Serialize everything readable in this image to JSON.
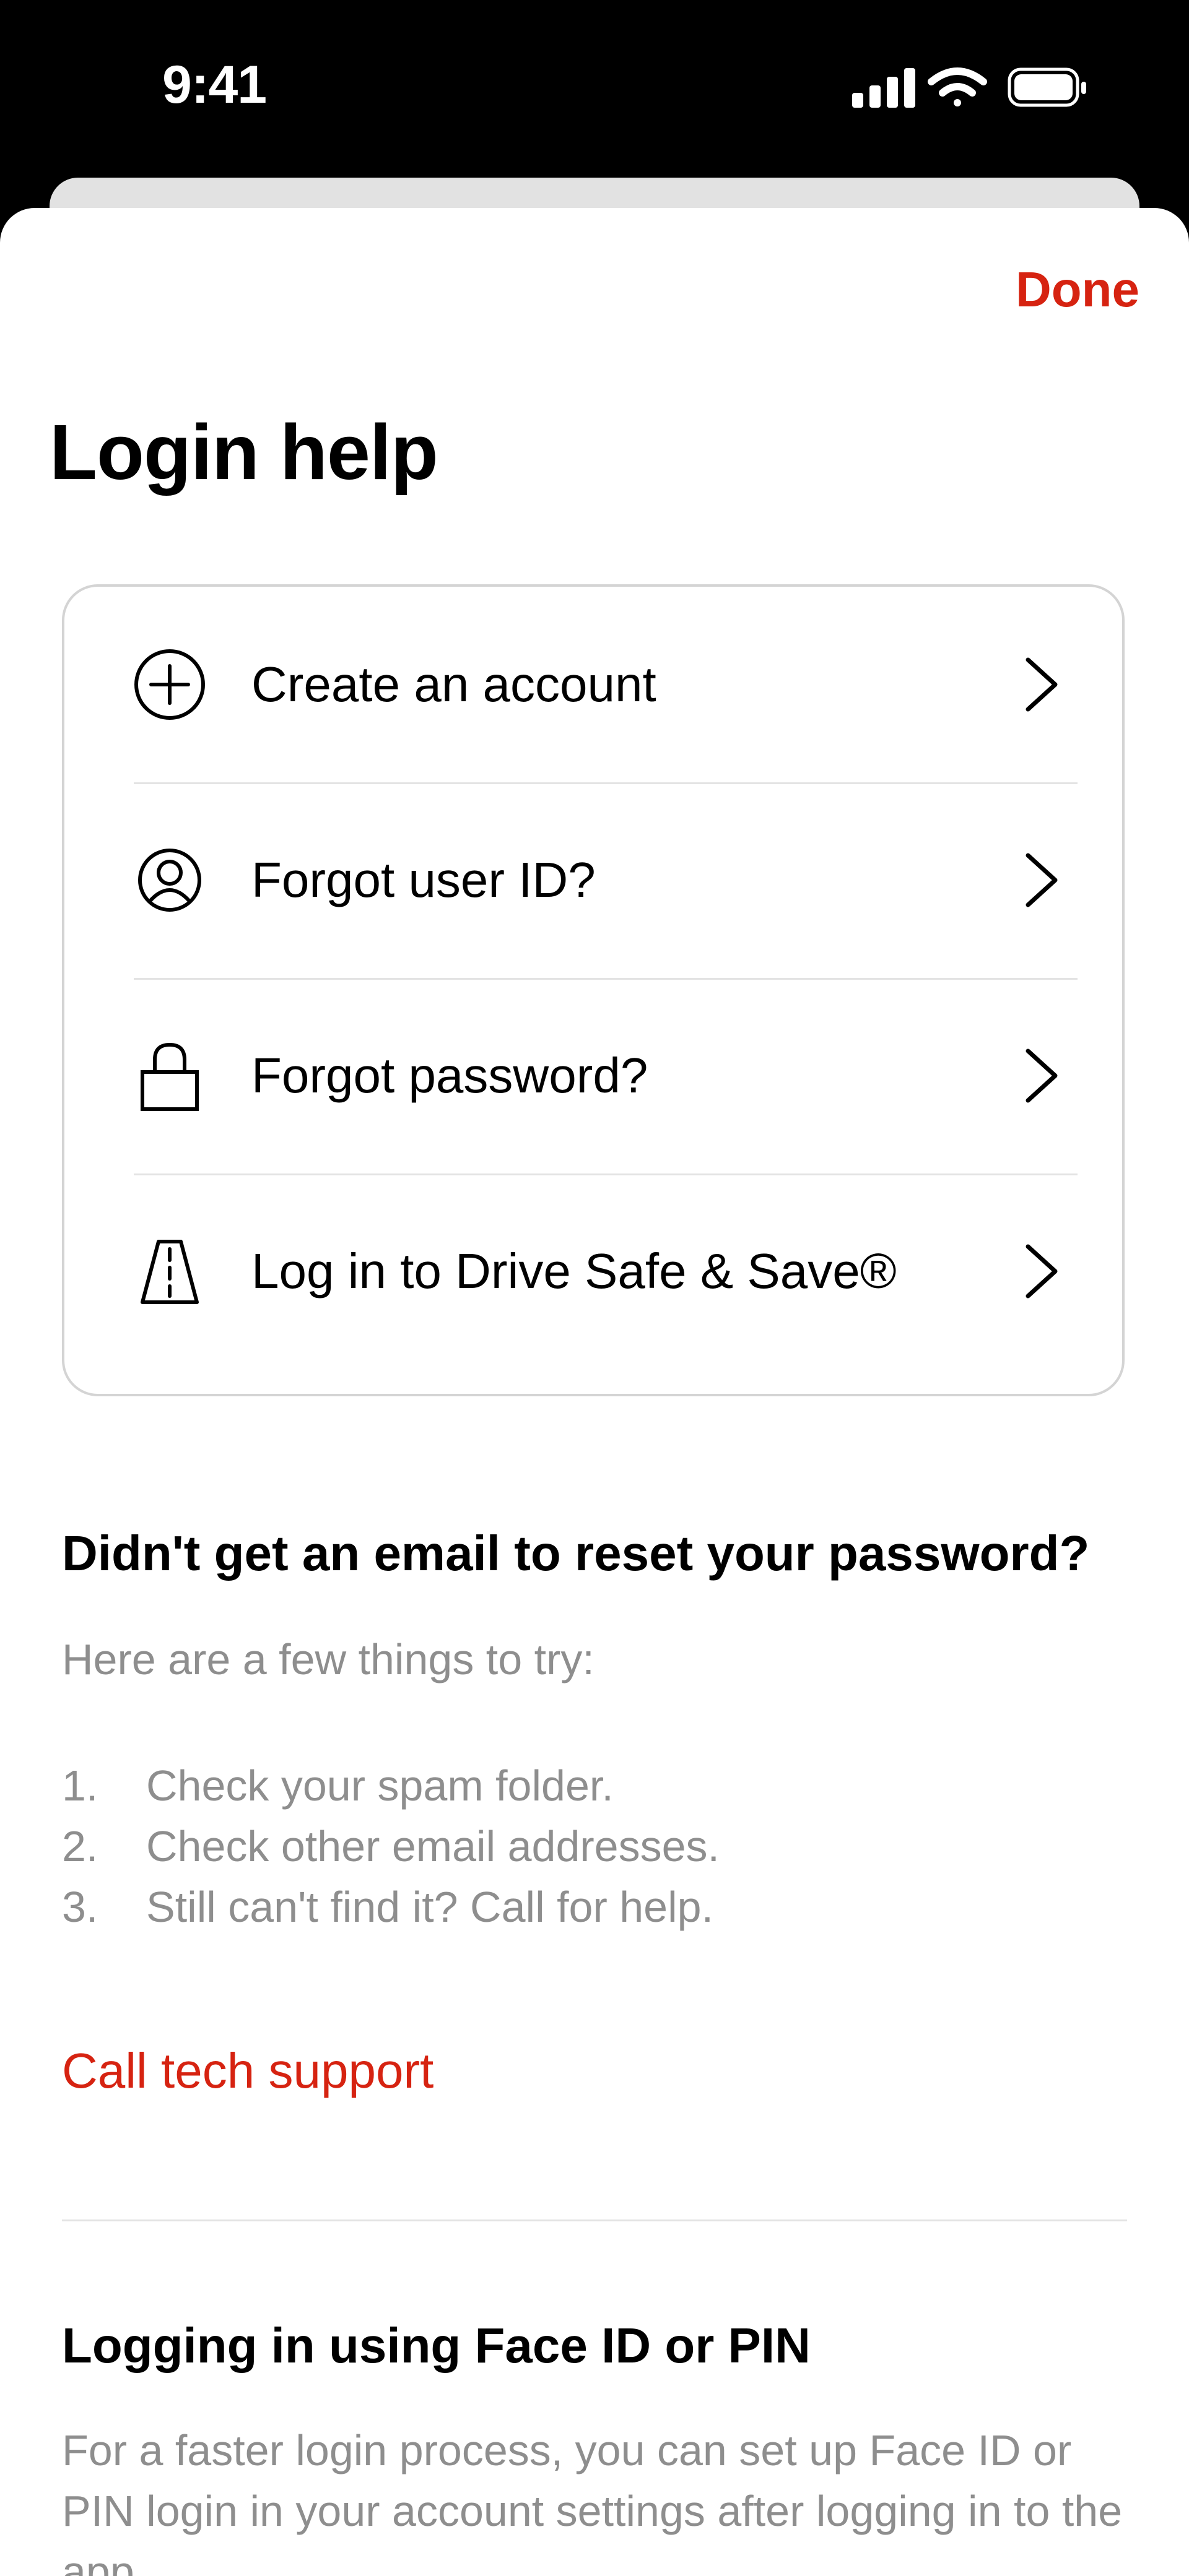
{
  "status_bar": {
    "time": "9:41",
    "icons": [
      "signal-icon",
      "wifi-icon",
      "battery-icon"
    ]
  },
  "header": {
    "done_label": "Done",
    "title": "Login help"
  },
  "menu": {
    "items": [
      {
        "label": "Create an account",
        "icon": "plus-circle-icon"
      },
      {
        "label": "Forgot user ID?",
        "icon": "user-circle-icon"
      },
      {
        "label": "Forgot password?",
        "icon": "lock-icon"
      },
      {
        "label": "Log in to Drive Safe & Save®",
        "icon": "road-icon"
      }
    ]
  },
  "reset_help": {
    "heading": "Didn't get an email to reset your password?",
    "intro": "Here are a few things to try:",
    "steps": [
      {
        "num": "1.",
        "text": "Check your spam folder."
      },
      {
        "num": "2.",
        "text": "Check other email addresses."
      },
      {
        "num": "3.",
        "text": "Still can't find it? Call for help."
      }
    ],
    "support_link": "Call tech support"
  },
  "faceid": {
    "heading": "Logging in using Face ID or PIN",
    "text": "For a faster login process, you can set up Face ID or PIN login in your account settings after logging in to the app."
  },
  "colors": {
    "accent": "#d62311",
    "muted_text": "#8e8e8e",
    "divider": "#e3e3e3"
  }
}
